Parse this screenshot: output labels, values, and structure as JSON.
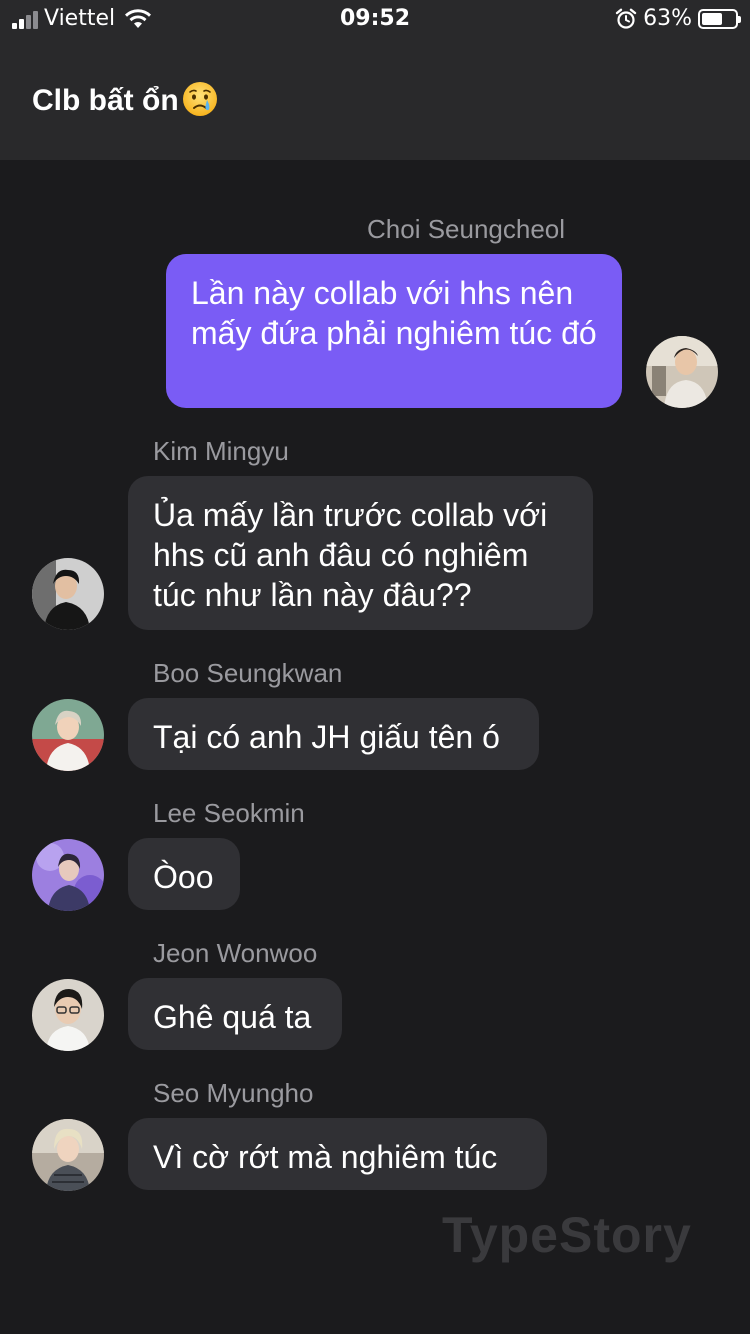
{
  "status_bar": {
    "carrier": "Viettel",
    "time": "09:52",
    "battery_percent": "63%",
    "battery_level": 0.63,
    "signal_bars_filled": 2,
    "signal_bars_total": 4,
    "icons": [
      "signal-icon",
      "wifi-icon",
      "alarm-icon",
      "battery-icon"
    ]
  },
  "header": {
    "title": "Clb bất ổn",
    "title_emoji": "crying-face-emoji"
  },
  "messages": [
    {
      "sender": "Choi Seungcheol",
      "text": "Lần này collab với hhs nên mấy đứa phải nghiêm túc đó",
      "outgoing": true
    },
    {
      "sender": "Kim Mingyu",
      "text": "Ủa mấy lần trước collab với hhs cũ anh đâu có nghiêm túc như lần này đâu??",
      "outgoing": false
    },
    {
      "sender": "Boo Seungkwan",
      "text": "Tại có anh JH giấu tên ó",
      "outgoing": false
    },
    {
      "sender": "Lee Seokmin",
      "text": "Òoo",
      "outgoing": false
    },
    {
      "sender": "Jeon Wonwoo",
      "text": "Ghê quá ta",
      "outgoing": false
    },
    {
      "sender": "Seo Myungho",
      "text": "Vì cờ rớt mà nghiêm túc",
      "outgoing": false
    }
  ],
  "watermark": "TypeStory",
  "colors": {
    "background": "#1b1b1d",
    "header": "#29292b",
    "outgoing_bubble": "#7a5cf5",
    "incoming_bubble": "#303034",
    "sender_name": "#9a9a9f",
    "watermark": "#3a3a3d"
  }
}
